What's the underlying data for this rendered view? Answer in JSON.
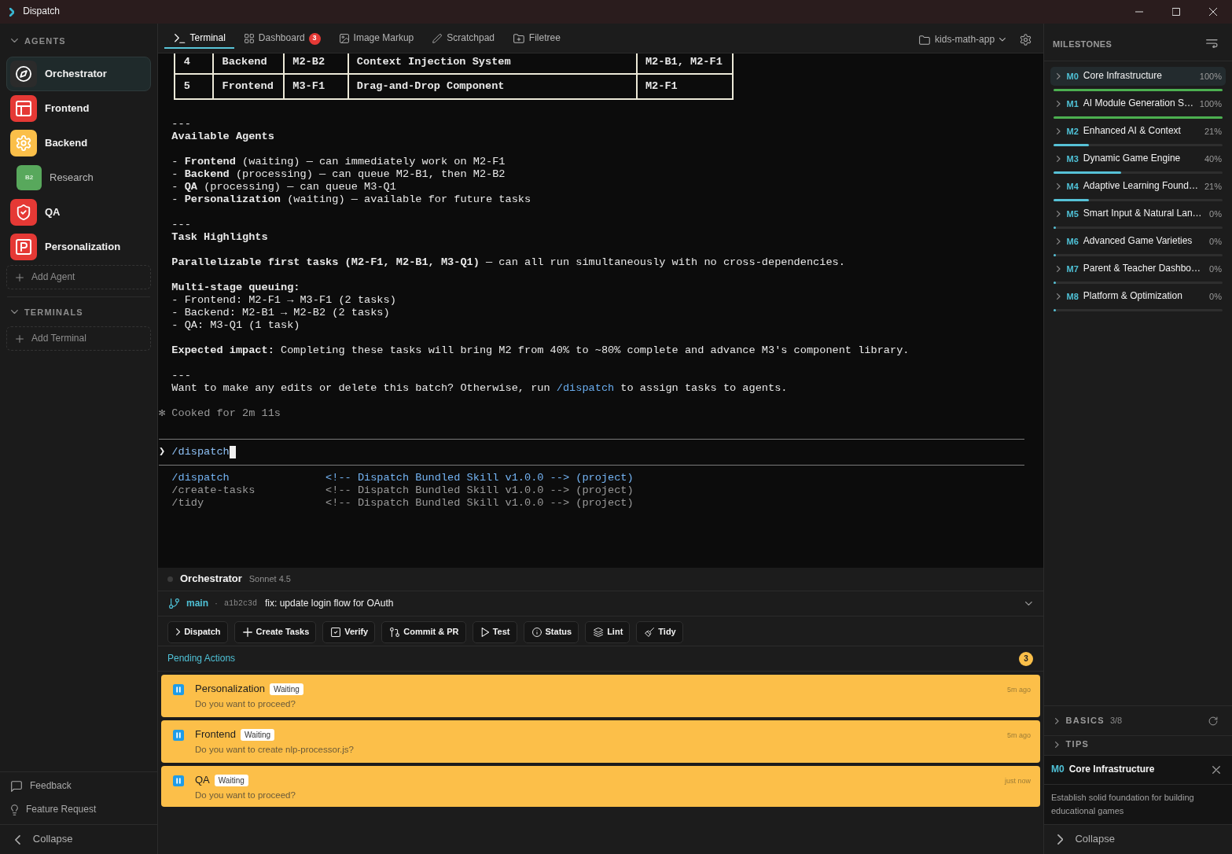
{
  "window": {
    "title": "Dispatch"
  },
  "sidebar": {
    "sections": [
      {
        "title": "AGENTS",
        "expanded": true,
        "items": [
          {
            "name": "Orchestrator",
            "color": "#2b2b2b",
            "selected": true
          },
          {
            "name": "Frontend",
            "color": "#e53935",
            "selected": false
          },
          {
            "name": "Backend",
            "color": "#fbbf49",
            "selected": false,
            "children": [
              {
                "name": "Research",
                "badge": "B2",
                "color": "#58a85c",
                "selected": false
              }
            ]
          },
          {
            "name": "QA",
            "color": "#e53935",
            "selected": false
          },
          {
            "name": "Personalization",
            "color": "#e53935",
            "selected": false
          }
        ],
        "add_label": "Add Agent"
      },
      {
        "title": "TERMINALS",
        "expanded": true,
        "add_label": "Add Terminal"
      }
    ],
    "footer_links": [
      {
        "label": "Feedback"
      },
      {
        "label": "Feature Request"
      }
    ],
    "collapse_label": "Collapse"
  },
  "tabs": [
    {
      "label": "Terminal",
      "selected": true
    },
    {
      "label": "Dashboard",
      "selected": false,
      "badge": "3"
    },
    {
      "label": "Image Markup",
      "selected": false
    },
    {
      "label": "Scratchpad",
      "selected": false
    },
    {
      "label": "Filetree",
      "selected": false
    }
  ],
  "project": {
    "label": "kids-math-app"
  },
  "terminal": {
    "table": {
      "rows": [
        {
          "cells": [
            "4",
            "Backend",
            "M2-B2",
            "Context Injection System",
            "M2-B1, M2-F1"
          ]
        },
        {
          "cells": [
            "5",
            "Frontend",
            "M3-F1",
            "Drag-and-Drop Component",
            "M2-F1"
          ]
        }
      ]
    },
    "blocks": [
      {
        "lines": [
          {
            "kind": "text",
            "text": "---"
          },
          {
            "kind": "heading",
            "text": "Available Agents"
          }
        ]
      },
      {
        "lines": [
          {
            "kind": "text",
            "text": "- **Frontend** (waiting) — can immediately work on M2-F1"
          },
          {
            "kind": "text",
            "text": "- **Backend** (processing) — can queue M2-B1, then M2-B2"
          },
          {
            "kind": "text",
            "text": "- **QA** (processing) — can queue M3-Q1"
          },
          {
            "kind": "text",
            "text": "- **Personalization** (waiting) — available for future tasks"
          }
        ]
      },
      {
        "lines": [
          {
            "kind": "text",
            "text": "---"
          },
          {
            "kind": "heading",
            "text": "Task Highlights"
          }
        ]
      },
      {
        "lines": [
          {
            "kind": "text",
            "text": "**Parallelizable first tasks (M2-F1, M2-B1, M3-Q1)** — can all run simultaneously with no cross-dependencies."
          }
        ]
      },
      {
        "lines": [
          {
            "kind": "heading",
            "text": "Multi-stage queuing:"
          },
          {
            "kind": "text",
            "text": "- Frontend: M2-F1 → M3-F1 (2 tasks)"
          },
          {
            "kind": "text",
            "text": "- Backend: M2-B1 → M2-B2 (2 tasks)"
          },
          {
            "kind": "text",
            "text": "- QA: M3-Q1 (1 task)"
          }
        ]
      },
      {
        "lines": [
          {
            "kind": "text",
            "text": "**Expected impact:** Completing these tasks will bring M2 from 40% to ~80% complete and advance M3's component library."
          }
        ]
      },
      {
        "lines": [
          {
            "kind": "text",
            "text": "---"
          },
          {
            "kind": "command_hint",
            "before": "Want to make any edits or delete this batch? Otherwise, run ",
            "command": "/dispatch",
            "after": " to assign tasks to agents."
          }
        ]
      }
    ],
    "status": "✻ Cooked for 2m 11s",
    "prompt": {
      "symbol": "❯",
      "value": "/dispatch"
    },
    "suggestions": [
      {
        "command": "/dispatch",
        "description": "<!-- Dispatch Bundled Skill v1.0.0 --> (project)",
        "selected": true
      },
      {
        "command": "/create-tasks",
        "description": "<!-- Dispatch Bundled Skill v1.0.0 --> (project)",
        "selected": false
      },
      {
        "command": "/tidy",
        "description": "<!-- Dispatch Bundled Skill v1.0.0 --> (project)",
        "selected": false
      }
    ]
  },
  "session": {
    "agent": "Orchestrator",
    "model": "Sonnet 4.5",
    "branch": "main",
    "separator": "·",
    "commit": "a1b2c3d",
    "message": "fix: update login flow for OAuth"
  },
  "actions": [
    {
      "label": "Dispatch"
    },
    {
      "label": "Create Tasks"
    },
    {
      "label": "Verify"
    },
    {
      "label": "Commit & PR"
    },
    {
      "label": "Test"
    },
    {
      "label": "Status"
    },
    {
      "label": "Lint"
    },
    {
      "label": "Tidy"
    }
  ],
  "pending": {
    "title": "Pending Actions",
    "count": "3",
    "items": [
      {
        "agent": "Personalization",
        "status": "Waiting",
        "message": "Do you want to proceed?",
        "time": "5m ago"
      },
      {
        "agent": "Frontend",
        "status": "Waiting",
        "message": "Do you want to create nlp-processor.js?",
        "time": "5m ago"
      },
      {
        "agent": "QA",
        "status": "Waiting",
        "message": "Do you want to proceed?",
        "time": "just now"
      }
    ]
  },
  "milestones": {
    "title": "MILESTONES",
    "items": [
      {
        "code": "M0",
        "name": "Core Infrastructure",
        "percent": "100%",
        "level": 1,
        "selected": true,
        "expanded": false
      },
      {
        "code": "M1",
        "name": "AI Module Generation S…",
        "percent": "100%",
        "level": 1,
        "selected": false,
        "expanded": false
      },
      {
        "code": "M2",
        "name": "Enhanced AI & Context",
        "percent": "21%",
        "level": 0.21,
        "selected": false,
        "expanded": false
      },
      {
        "code": "M3",
        "name": "Dynamic Game Engine",
        "percent": "40%",
        "level": 0.4,
        "selected": false,
        "expanded": false
      },
      {
        "code": "M4",
        "name": "Adaptive Learning Found…",
        "percent": "21%",
        "level": 0.21,
        "selected": false,
        "expanded": false
      },
      {
        "code": "M5",
        "name": "Smart Input & Natural Lan…",
        "percent": "0%",
        "level": 0,
        "selected": false,
        "expanded": false
      },
      {
        "code": "M6",
        "name": "Advanced Game Varieties",
        "percent": "0%",
        "level": 0,
        "selected": false,
        "expanded": false
      },
      {
        "code": "M7",
        "name": "Parent & Teacher Dashbo…",
        "percent": "0%",
        "level": 0,
        "selected": false,
        "expanded": false
      },
      {
        "code": "M8",
        "name": "Platform & Optimization",
        "percent": "0%",
        "level": 0,
        "selected": false,
        "expanded": false
      }
    ]
  },
  "basics": {
    "title": "BASICS",
    "count": "3/8",
    "expanded": false
  },
  "tips": {
    "title": "TIPS",
    "expanded": false
  },
  "detail": {
    "code": "M0",
    "name": "Core Infrastructure",
    "description": "Establish solid foundation for building educational games"
  },
  "right_collapse_label": "Collapse"
}
